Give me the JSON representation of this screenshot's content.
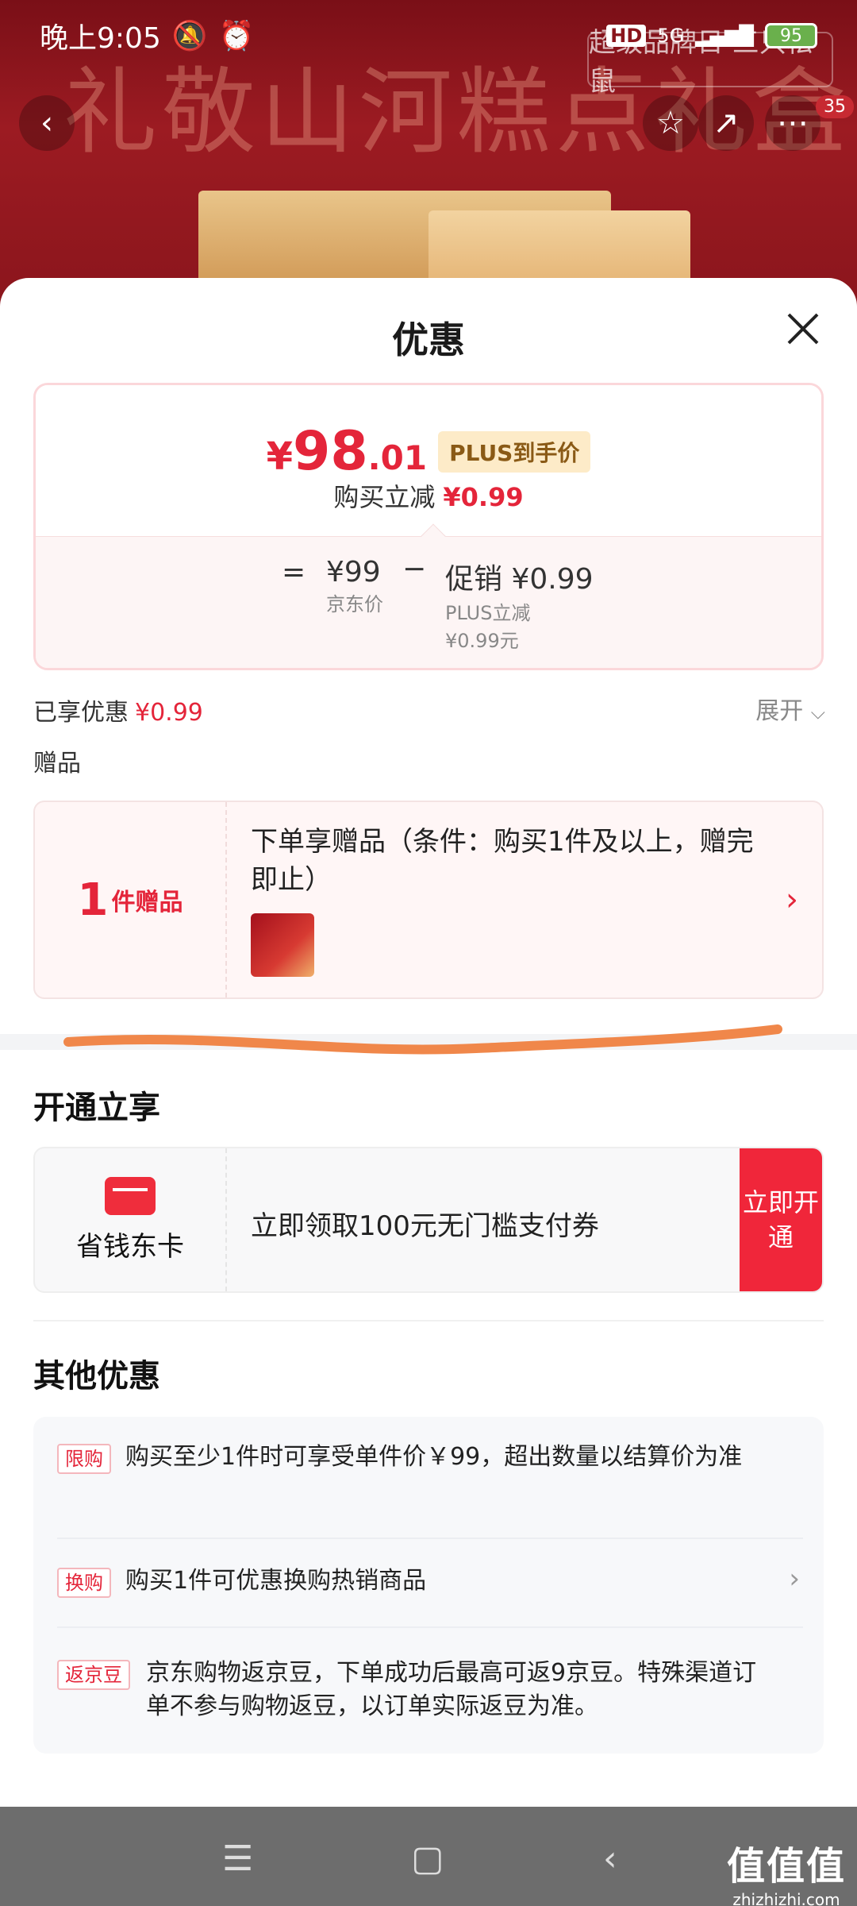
{
  "status_bar": {
    "time": "晚上9:05",
    "network": "5G",
    "hd": "HD",
    "battery": "95"
  },
  "banner": {
    "title": "礼敬山河糕点礼盒",
    "brand_event": "超级品牌日 三只松鼠",
    "badge_count": "35"
  },
  "sheet": {
    "title": "优惠",
    "price": {
      "yen": "¥",
      "integer": "98",
      "decimal": ".01",
      "plus_tag": "PLUS到手价",
      "reduce_label": "购买立减",
      "reduce_value": "¥0.99"
    },
    "formula": {
      "eq": "=",
      "jd_price": "¥99",
      "jd_price_label": "京东价",
      "minus": "−",
      "promo_label": "促销",
      "promo_value": "¥0.99",
      "plus_reduce_label": "PLUS立减",
      "plus_reduce_value": "¥0.99元"
    },
    "enjoyed": {
      "label": "已享优惠",
      "value": "¥0.99",
      "expand": "展开"
    },
    "gift": {
      "section_label": "赠品",
      "count": "1",
      "count_unit": "件赠品",
      "description": "下单享赠品（条件：购买1件及以上，赠完即止）"
    },
    "open_section": {
      "title": "开通立享",
      "card_label": "省钱东卡",
      "description": "立即领取100元无门槛支付券",
      "button": "立即开通"
    },
    "other": {
      "title": "其他优惠",
      "items": [
        {
          "tag": "限购",
          "text": "购买至少1件时可享受单件价￥99，超出数量以结算价为准"
        },
        {
          "tag": "换购",
          "text": "购买1件可优惠换购热销商品"
        },
        {
          "tag": "返京豆",
          "text": "京东购物返京豆，下单成功后最高可返9京豆。特殊渠道订单不参与购物返豆，以订单实际返豆为准。"
        }
      ]
    }
  },
  "watermark": {
    "text": "值值值",
    "url": "zhizhizhi.com"
  }
}
